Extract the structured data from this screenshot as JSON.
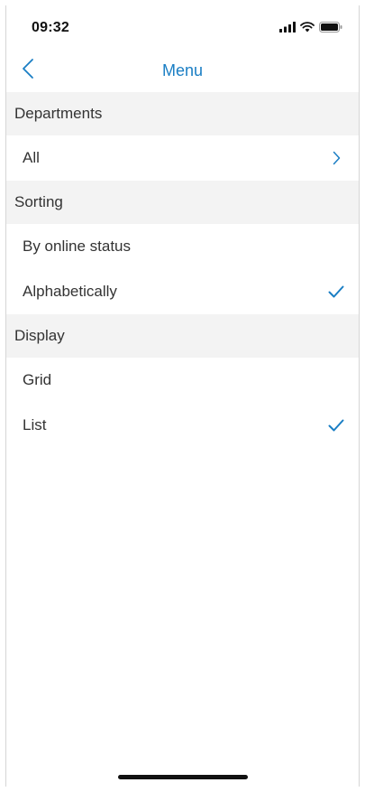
{
  "status_bar": {
    "time": "09:32",
    "icons": [
      "signal-icon",
      "wifi-icon",
      "battery-icon"
    ]
  },
  "nav": {
    "title": "Menu",
    "back_icon": "chevron-left-icon"
  },
  "sections": {
    "departments": {
      "header": "Departments",
      "items": [
        {
          "label": "All",
          "trailing": "chevron-right-icon"
        }
      ]
    },
    "sorting": {
      "header": "Sorting",
      "items": [
        {
          "label": "By online status",
          "selected": false
        },
        {
          "label": "Alphabetically",
          "selected": true
        }
      ]
    },
    "display": {
      "header": "Display",
      "items": [
        {
          "label": "Grid",
          "selected": false
        },
        {
          "label": "List",
          "selected": true
        }
      ]
    }
  },
  "colors": {
    "accent": "#1a7ec4",
    "section_background": "#f3f3f3",
    "text": "#333333"
  }
}
